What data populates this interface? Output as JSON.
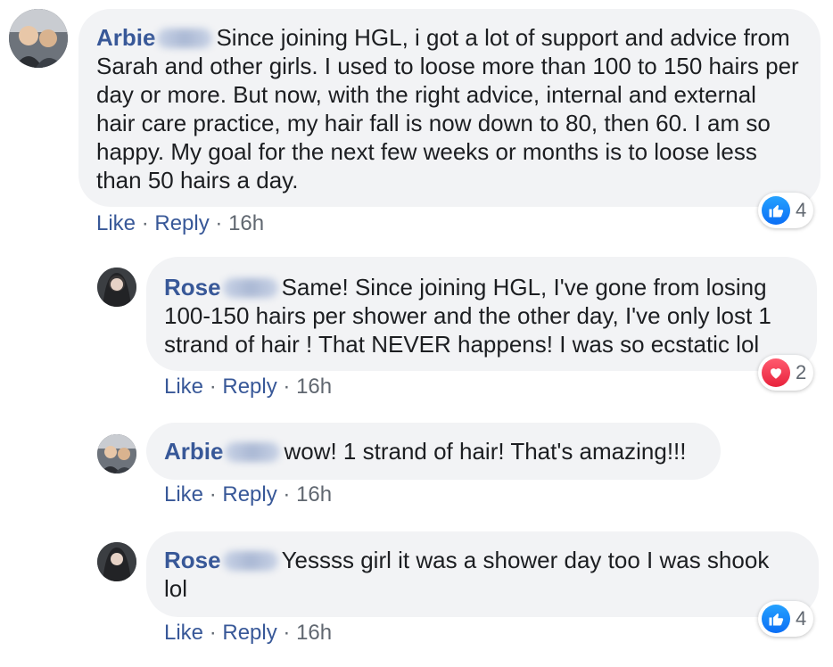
{
  "colors": {
    "author": "#385898",
    "bubble": "#f2f3f5",
    "like": "#1877f2",
    "love": "#f33e58",
    "muted": "#606770"
  },
  "comments": [
    {
      "author": "Arbie",
      "text": "Since joining HGL, i got a lot of support and advice from Sarah and other girls. I used to loose more than 100 to 150 hairs per day or more. But now, with the right advice, internal and external hair care practice, my hair fall is now down to 80, then 60. I am so happy. My goal for the next few weeks or months is to loose less than 50 hairs a day.",
      "like": "Like",
      "reply": "Reply",
      "time": "16h",
      "reaction": {
        "icon": "thumbs-up-icon",
        "count": "4"
      }
    },
    {
      "author": "Rose",
      "text": "Same! Since joining HGL, I've gone from losing 100-150 hairs per shower and the other day, I've only lost 1 strand of hair ! That NEVER happens! I was so ecstatic lol",
      "like": "Like",
      "reply": "Reply",
      "time": "16h",
      "reaction": {
        "icon": "heart-icon",
        "count": "2"
      }
    },
    {
      "author": "Arbie",
      "text": "wow! 1 strand of hair! That's amazing!!!",
      "like": "Like",
      "reply": "Reply",
      "time": "16h"
    },
    {
      "author": "Rose",
      "text": "Yessss girl it was a shower day too I was shook lol",
      "like": "Like",
      "reply": "Reply",
      "time": "16h",
      "reaction": {
        "icon": "thumbs-up-icon",
        "count": "4"
      }
    }
  ],
  "separator": "·"
}
